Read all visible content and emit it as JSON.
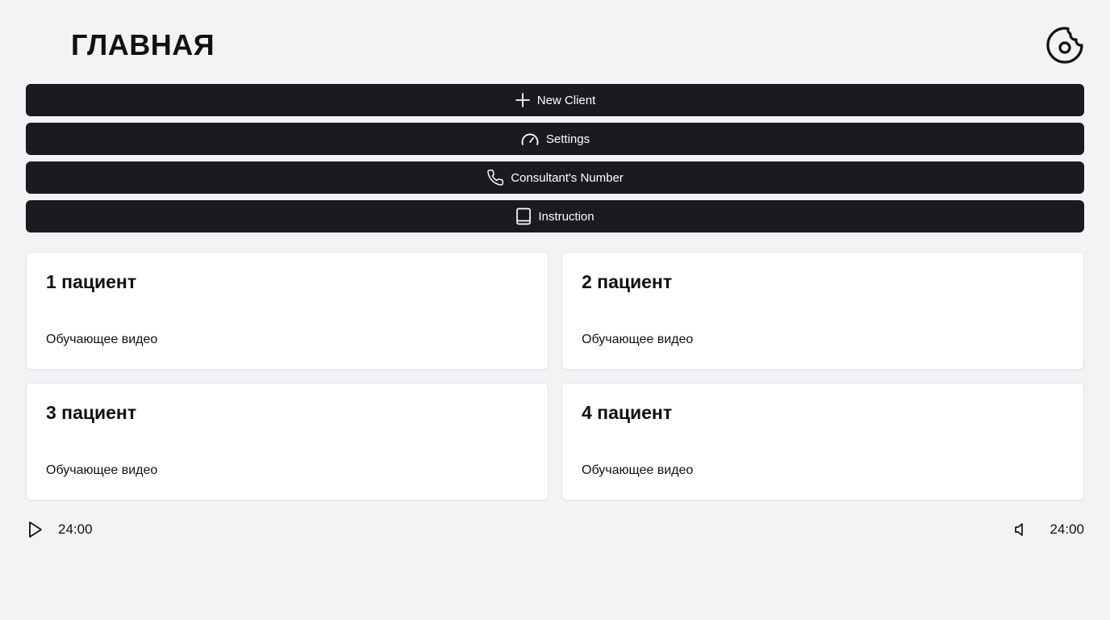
{
  "header": {
    "title": "ГЛАВНАЯ",
    "cookie_icon": "cookie-icon"
  },
  "actions": [
    {
      "label": "New Client",
      "icon": "plus-icon"
    },
    {
      "label": "Settings",
      "icon": "gauge-icon"
    },
    {
      "label": "Consultant's Number",
      "icon": "phone-icon"
    },
    {
      "label": "Instruction",
      "icon": "book-icon"
    }
  ],
  "cards": [
    {
      "title": "1 пациент",
      "subtitle": "Обучающее видео"
    },
    {
      "title": "2 пациент",
      "subtitle": "Обучающее видео"
    },
    {
      "title": "3 пациент",
      "subtitle": "Обучающее видео"
    },
    {
      "title": "4 пациент",
      "subtitle": "Обучающее видео"
    }
  ],
  "player": {
    "time_left": "24:00",
    "time_right": "24:00",
    "play_icon": "play-icon",
    "volume_icon": "volume-icon"
  },
  "colors": {
    "background": "#f2f3f5",
    "button_bg": "#1a1b1e",
    "card_bg": "#ffffff",
    "text": "#111111"
  }
}
